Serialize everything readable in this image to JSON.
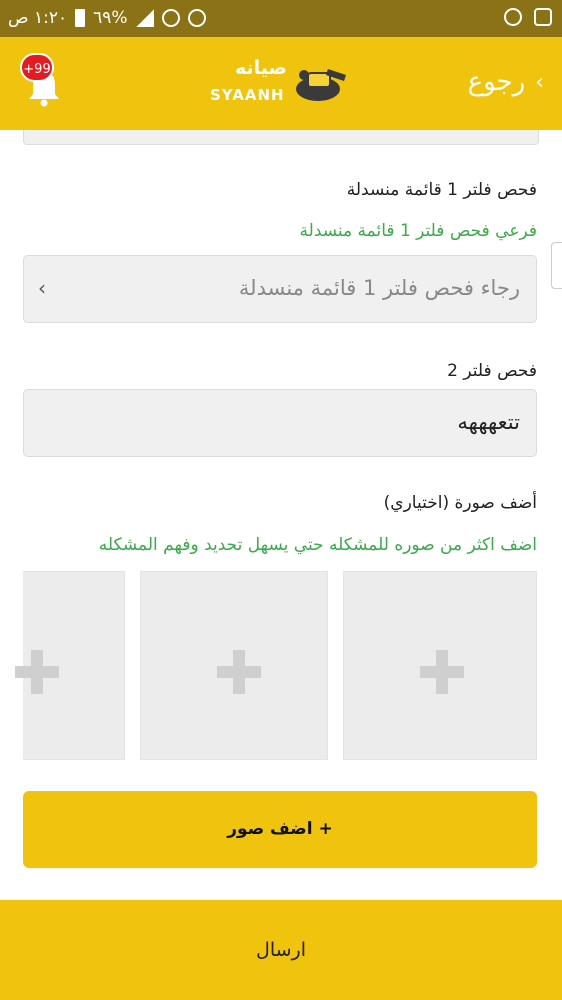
{
  "status_bar": {
    "time": "١:٢٠ ص",
    "battery": "٦٩%",
    "icons": [
      "alarm-icon",
      "wifi-icon",
      "signal-icon",
      "battery-icon",
      "mail-icon",
      "sync-icon"
    ]
  },
  "app_bar": {
    "back_label": "رجوع",
    "logo_text_ar": "صيانه",
    "logo_text_en": "SYAANH",
    "notification_badge": "+99"
  },
  "form": {
    "filter1": {
      "label": "فحص فلتر 1 قائمة منسدلة",
      "sub_label": "فرعي فحص فلتر 1 قائمة منسدلة",
      "placeholder": "رجاء فحص فلتر 1 قائمة منسدلة"
    },
    "filter2": {
      "label": "فحص فلتر 2",
      "value": "تتعهههه"
    },
    "photos": {
      "label": "أضف صورة (اختياري)",
      "hint": "اضف اكثر من صوره للمشكله حتي يسهل تحديد وفهم المشكله",
      "slots": 3
    },
    "add_photos_button": "+ اضف صور",
    "submit_button": "ارسال"
  },
  "colors": {
    "brand_yellow": "#f0c30e",
    "status_bar": "#8b7216",
    "hint_green": "#3aaa4a",
    "badge_red": "#e31b23"
  }
}
